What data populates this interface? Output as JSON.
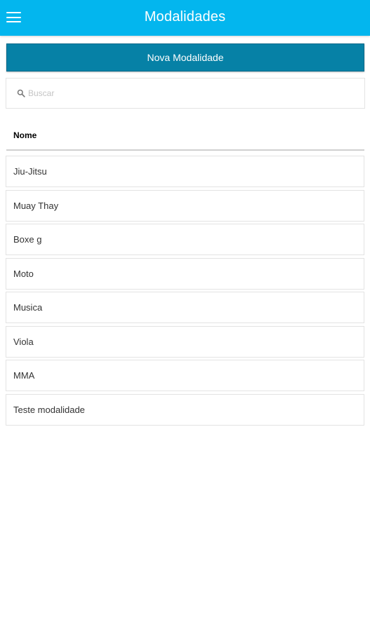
{
  "header": {
    "title": "Modalidades",
    "menu_icon": "hamburger-menu-icon",
    "background_color": "#03b6ee"
  },
  "actions": {
    "new_button_label": "Nova Modalidade",
    "button_color": "#0681a6"
  },
  "search": {
    "placeholder": "Buscar",
    "value": "",
    "icon": "search-icon"
  },
  "table": {
    "column_header": "Nome",
    "rows": [
      "Jiu-Jitsu",
      "Muay Thay",
      "Boxe g",
      "Moto",
      "Musica",
      "Viola",
      "MMA",
      "Teste modalidade"
    ]
  }
}
